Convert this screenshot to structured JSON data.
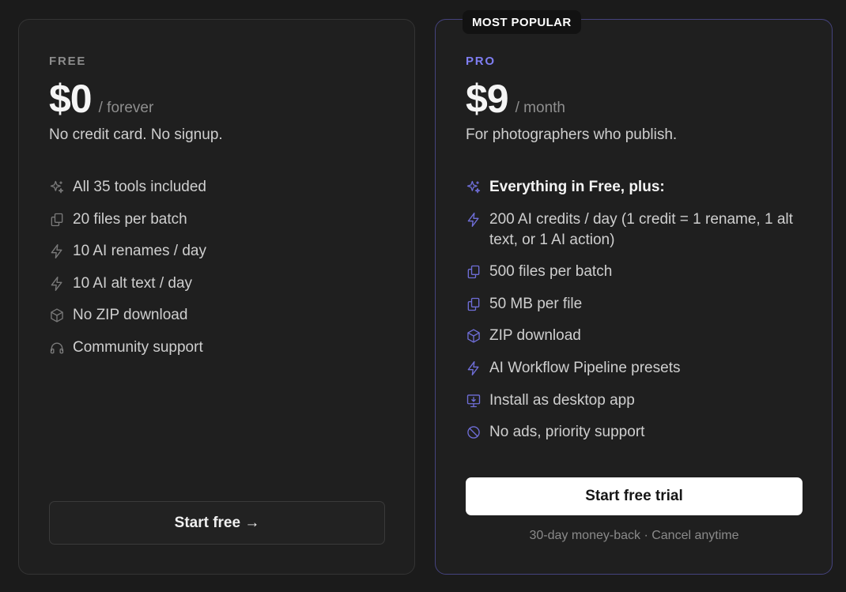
{
  "free": {
    "tier": "FREE",
    "price": "$0",
    "period": "/ forever",
    "description": "No credit card. No signup.",
    "features": [
      {
        "icon": "sparkles-icon",
        "text": "All 35 tools included"
      },
      {
        "icon": "files-icon",
        "text": "20 files per batch"
      },
      {
        "icon": "bolt-icon",
        "text": "10 AI renames / day"
      },
      {
        "icon": "bolt-icon",
        "text": "10 AI alt text / day"
      },
      {
        "icon": "package-icon",
        "text": "No ZIP download"
      },
      {
        "icon": "headphones-icon",
        "text": "Community support"
      }
    ],
    "cta": "Start free →"
  },
  "pro": {
    "badge": "MOST POPULAR",
    "tier": "PRO",
    "price": "$9",
    "period": "/ month",
    "description": "For photographers who publish.",
    "features": [
      {
        "icon": "sparkles-icon",
        "text": "Everything in Free, plus:"
      },
      {
        "icon": "bolt-icon",
        "text": "200 AI credits / day (1 credit = 1 rename, 1 alt text, or 1 AI action)"
      },
      {
        "icon": "files-icon",
        "text": "500 files per batch"
      },
      {
        "icon": "files-icon",
        "text": "50 MB per file"
      },
      {
        "icon": "package-icon",
        "text": "ZIP download"
      },
      {
        "icon": "bolt-icon",
        "text": "AI Workflow Pipeline presets"
      },
      {
        "icon": "monitor-download-icon",
        "text": "Install as desktop app"
      },
      {
        "icon": "ban-icon",
        "text": "No ads, priority support"
      }
    ],
    "cta": "Start free trial",
    "note": "30-day money-back · Cancel anytime"
  },
  "colors": {
    "background": "#1b1b1b",
    "card": "#1f1f1f",
    "accent": "#7f7ef2",
    "pro_border": "#45437e"
  }
}
